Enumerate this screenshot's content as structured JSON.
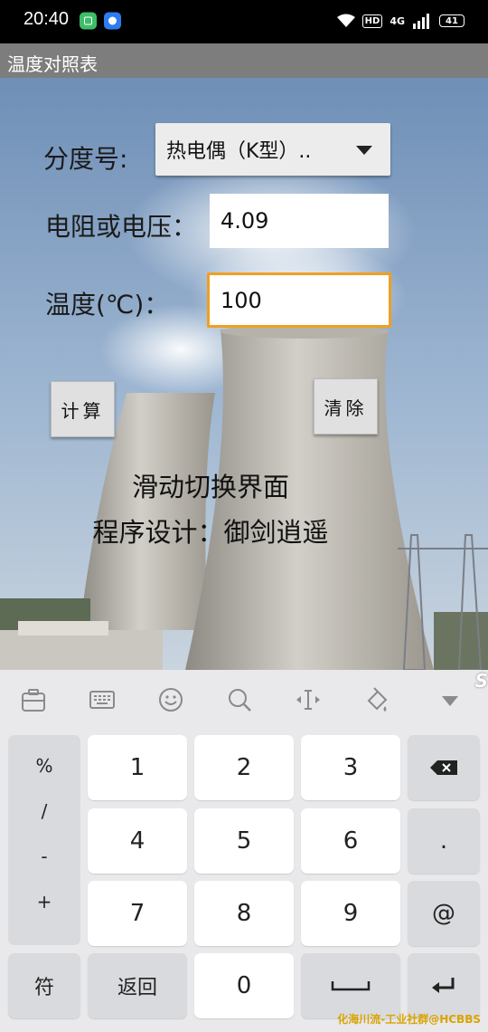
{
  "status_bar": {
    "time": "20:40",
    "hd": "HD",
    "signal": "4G",
    "battery": "41"
  },
  "app": {
    "title": "温度对照表"
  },
  "form": {
    "division_label": "分度号:",
    "division_value": "热电偶（K型）..",
    "resistance_label": "电阻或电压：",
    "resistance_value": "4.09",
    "temperature_label": "温度(℃)：",
    "temperature_value": "100",
    "calc_button": "计算",
    "clear_button": "清除",
    "swipe_hint": "滑动切换界面",
    "credit": "程序设计：御剑逍遥"
  },
  "keyboard": {
    "toolbar_icons": [
      "clipboard-icon",
      "keyboard-icon",
      "emoji-icon",
      "search-icon",
      "cursor-icon",
      "skin-icon",
      "collapse-icon"
    ],
    "symbols": [
      "%",
      "/",
      "-",
      "+"
    ],
    "digits": [
      "1",
      "2",
      "3",
      "4",
      "5",
      "6",
      "7",
      "8",
      "9"
    ],
    "dot": ".",
    "at": "@",
    "symbol_key": "符",
    "back_key": "返回",
    "zero": "0",
    "space_key": "␣",
    "enter_key": "↵",
    "backspace_key": "⌫",
    "brand": "S"
  },
  "watermark": "化海川流-工业社群@HCBBS"
}
